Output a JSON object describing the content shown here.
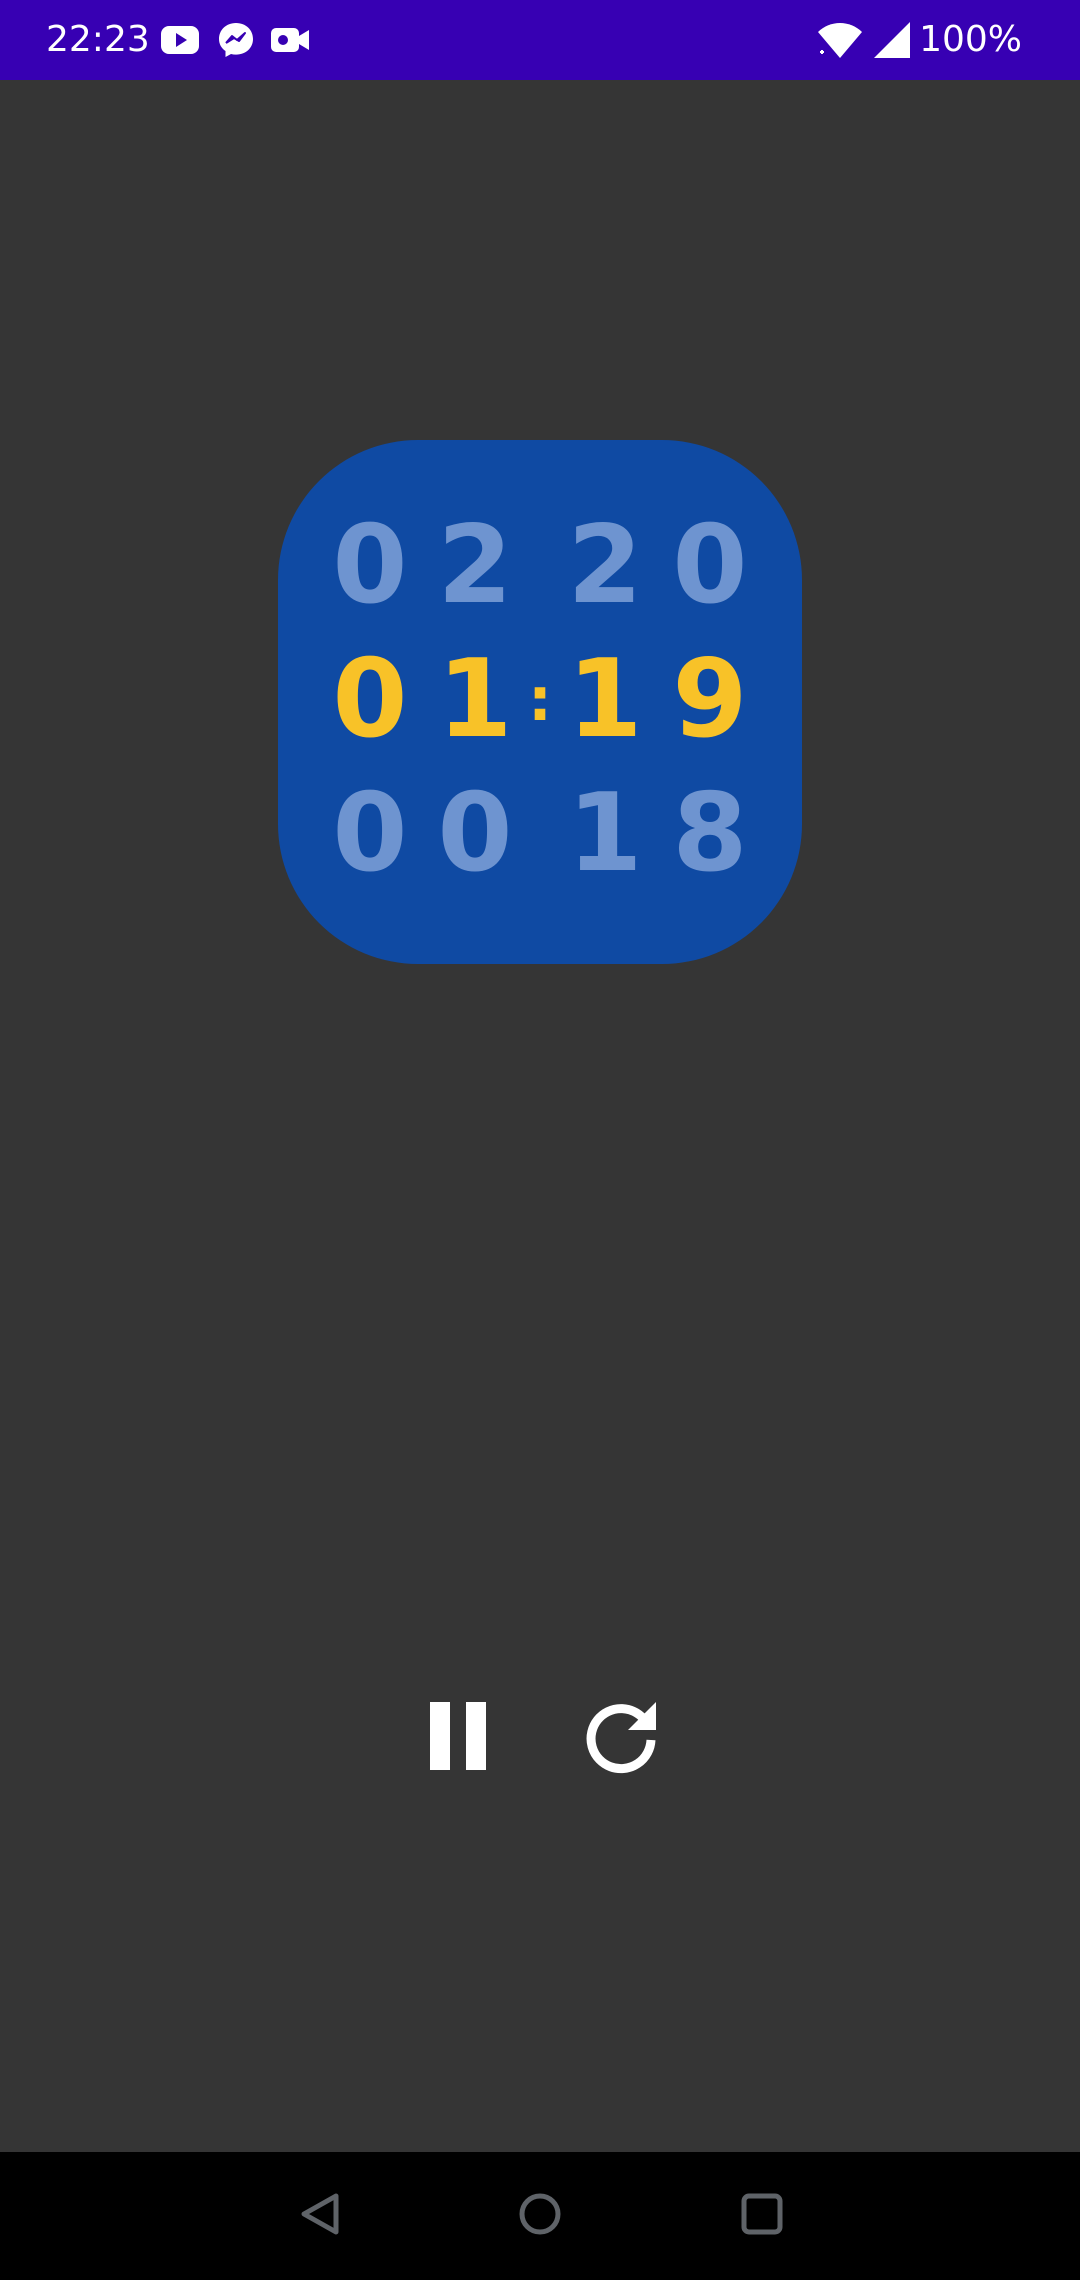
{
  "status_bar": {
    "time": "22:23",
    "battery": "100%",
    "notification_icons": [
      "youtube-icon",
      "messenger-icon",
      "video-camera-icon"
    ],
    "system_icons": [
      "wifi-icon",
      "signal-icon"
    ],
    "background_color": "#3700b3"
  },
  "timer": {
    "card_color": "#0f4aa3",
    "dim_digit_color": "#6e94d0",
    "active_digit_color": "#f8c228",
    "previous_row": {
      "d1": "0",
      "d2": "2",
      "d3": "2",
      "d4": "0"
    },
    "current_row": {
      "d1": "0",
      "d2": "1",
      "separator": ":",
      "d3": "1",
      "d4": "9"
    },
    "next_row": {
      "d1": "0",
      "d2": "0",
      "d3": "1",
      "d4": "8"
    }
  },
  "controls": {
    "pause_icon": "pause-icon",
    "reset_icon": "refresh-icon"
  },
  "nav_bar": {
    "buttons": [
      "back-icon",
      "home-icon",
      "recents-icon"
    ]
  },
  "background_color": "#353535"
}
